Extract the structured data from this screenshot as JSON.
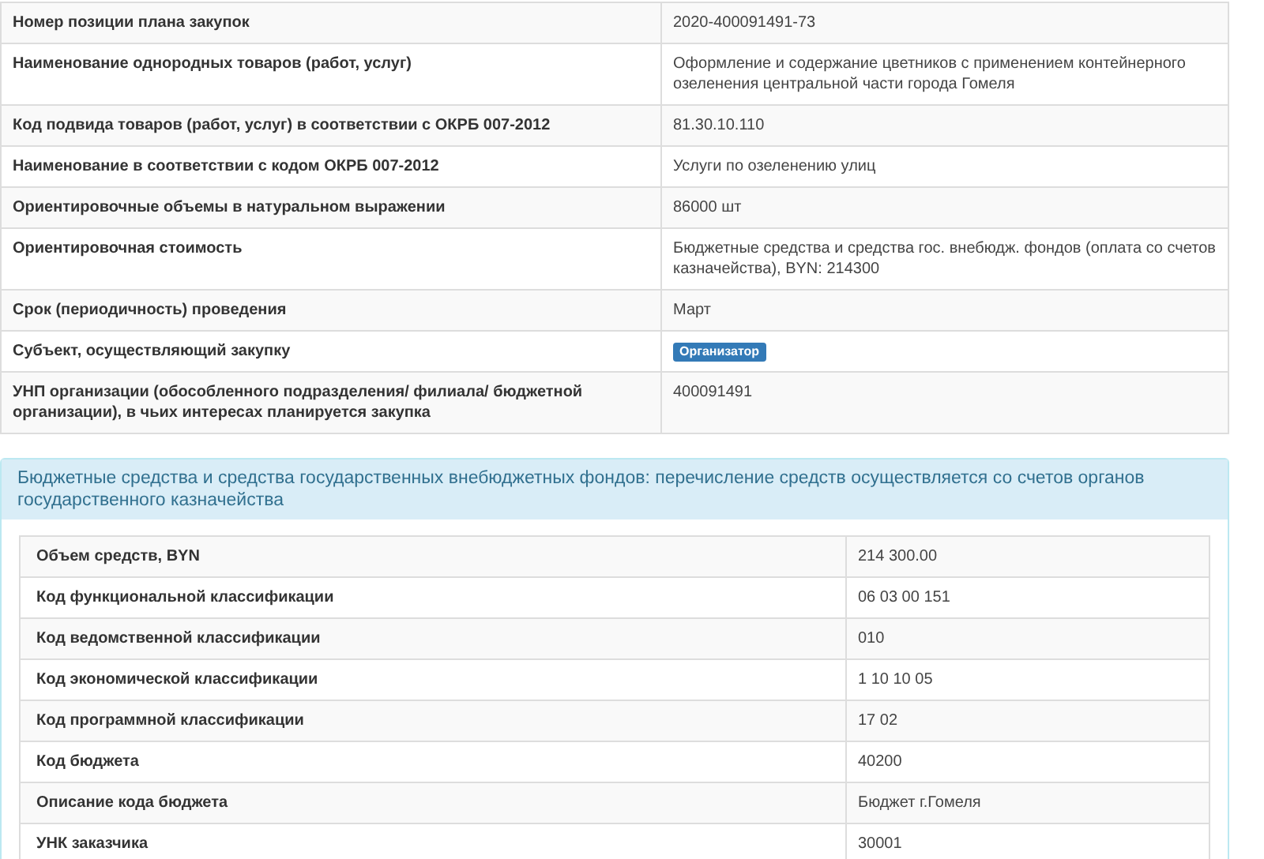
{
  "plan_table": {
    "rows": [
      {
        "label": "Номер позиции плана закупок",
        "value": "2020-400091491-73",
        "kind": "text"
      },
      {
        "label": "Наименование однородных товаров (работ, услуг)",
        "value": "Оформление и содержание цветников с применением контейнерного озеленения центральной части города Гомеля",
        "kind": "text"
      },
      {
        "label": "Код подвида товаров (работ, услуг) в соответствии с ОКРБ 007-2012",
        "value": "81.30.10.110",
        "kind": "text"
      },
      {
        "label": "Наименование в соответствии с кодом ОКРБ 007-2012",
        "value": "Услуги по озеленению улиц",
        "kind": "text"
      },
      {
        "label": "Ориентировочные объемы в натуральном выражении",
        "value": "86000 шт",
        "kind": "text"
      },
      {
        "label": "Ориентировочная стоимость",
        "value": "Бюджетные средства и средства гос. внебюдж. фондов (оплата со счетов казначейства), BYN: 214300",
        "kind": "text"
      },
      {
        "label": "Срок (периодичность) проведения",
        "value": "Март",
        "kind": "text"
      },
      {
        "label": "Субъект, осуществляющий закупку",
        "value": "Организатор",
        "kind": "badge"
      },
      {
        "label": "УНП организации (обособленного подразделения/ филиала/ бюджетной организации), в чьих интересах планируется закупка",
        "value": "400091491",
        "kind": "text"
      }
    ]
  },
  "funding_panel": {
    "heading": "Бюджетные средства и средства государственных внебюджетных фондов: перечисление средств осуществляется со счетов органов государственного казначейства",
    "rows": [
      {
        "label": "Объем средств, BYN",
        "value": "214 300.00"
      },
      {
        "label": "Код функциональной классификации",
        "value": "06 03 00 151"
      },
      {
        "label": "Код ведомственной классификации",
        "value": "010"
      },
      {
        "label": "Код экономической классификации",
        "value": "1 10 10 05"
      },
      {
        "label": "Код программной классификации",
        "value": "17 02"
      },
      {
        "label": "Код бюджета",
        "value": "40200"
      },
      {
        "label": "Описание кода бюджета",
        "value": "Бюджет г.Гомеля"
      },
      {
        "label": "УНК заказчика",
        "value": "30001"
      }
    ]
  }
}
